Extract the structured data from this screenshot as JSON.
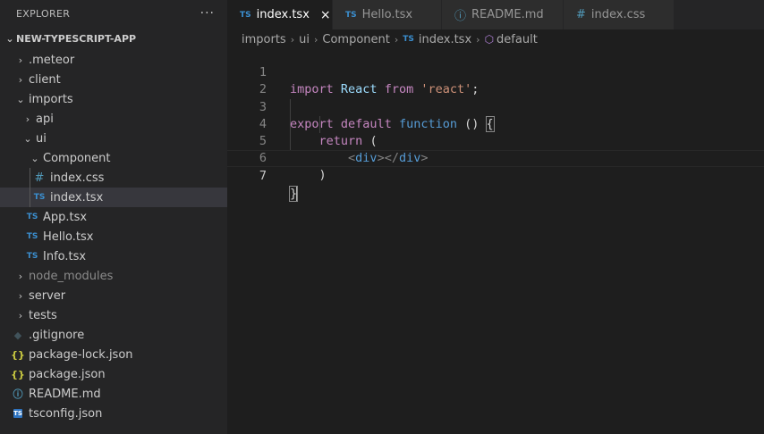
{
  "sidebar": {
    "title": "EXPLORER",
    "more": "···",
    "root": "NEW-TYPESCRIPT-APP",
    "items": [
      {
        "label": ".meteor",
        "type": "folder",
        "state": "collapsed"
      },
      {
        "label": "client",
        "type": "folder",
        "state": "collapsed"
      },
      {
        "label": "imports",
        "type": "folder",
        "state": "expanded"
      },
      {
        "label": "api",
        "type": "folder",
        "state": "collapsed"
      },
      {
        "label": "ui",
        "type": "folder",
        "state": "expanded"
      },
      {
        "label": "Component",
        "type": "folder",
        "state": "expanded"
      },
      {
        "label": "index.css",
        "type": "file",
        "icon": "css-file-icon"
      },
      {
        "label": "index.tsx",
        "type": "file",
        "icon": "ts-file-icon",
        "selected": true
      },
      {
        "label": "App.tsx",
        "type": "file",
        "icon": "ts-file-icon"
      },
      {
        "label": "Hello.tsx",
        "type": "file",
        "icon": "ts-file-icon"
      },
      {
        "label": "Info.tsx",
        "type": "file",
        "icon": "ts-file-icon"
      },
      {
        "label": "node_modules",
        "type": "folder",
        "state": "collapsed",
        "dimmed": true
      },
      {
        "label": "server",
        "type": "folder",
        "state": "collapsed"
      },
      {
        "label": "tests",
        "type": "folder",
        "state": "collapsed"
      },
      {
        "label": ".gitignore",
        "type": "file",
        "icon": "git-file-icon"
      },
      {
        "label": "package-lock.json",
        "type": "file",
        "icon": "json-file-icon"
      },
      {
        "label": "package.json",
        "type": "file",
        "icon": "json-file-icon"
      },
      {
        "label": "README.md",
        "type": "file",
        "icon": "info-file-icon"
      },
      {
        "label": "tsconfig.json",
        "type": "file",
        "icon": "tsconfig-file-icon"
      }
    ]
  },
  "tabs": [
    {
      "label": "index.tsx",
      "icon": "TS",
      "active": true,
      "close": "×"
    },
    {
      "label": "Hello.tsx",
      "icon": "TS"
    },
    {
      "label": "README.md",
      "icon": "ⓘ"
    },
    {
      "label": "index.css",
      "icon": "#"
    }
  ],
  "breadcrumb": {
    "parts": [
      "imports",
      "ui",
      "Component"
    ],
    "file": "index.tsx",
    "file_icon": "TS",
    "symbol": "default"
  },
  "editor": {
    "line_numbers": [
      "1",
      "2",
      "3",
      "4",
      "5",
      "6",
      "7"
    ],
    "current_line": "7",
    "tokens": {
      "l1_import": "import",
      "l1_react": "React",
      "l1_from": "from",
      "l1_str": "'react'",
      "l1_semi": ";",
      "l3_export": "export",
      "l3_default": "default",
      "l3_function": "function",
      "l3_parens": "()",
      "l3_brace": "{",
      "l4_return": "return",
      "l4_paren": "(",
      "l5_open_lt": "<",
      "l5_open_tag": "div",
      "l5_open_gt": "></",
      "l5_close_tag": "div",
      "l5_close_gt": ">",
      "l6_paren": ")",
      "l7_brace": "}"
    }
  },
  "colors": {
    "accent_ts": "#3b8fd0",
    "keyword_control": "#c586c0",
    "keyword": "#569cd6",
    "string": "#ce9178",
    "variable": "#9cdcfe"
  }
}
